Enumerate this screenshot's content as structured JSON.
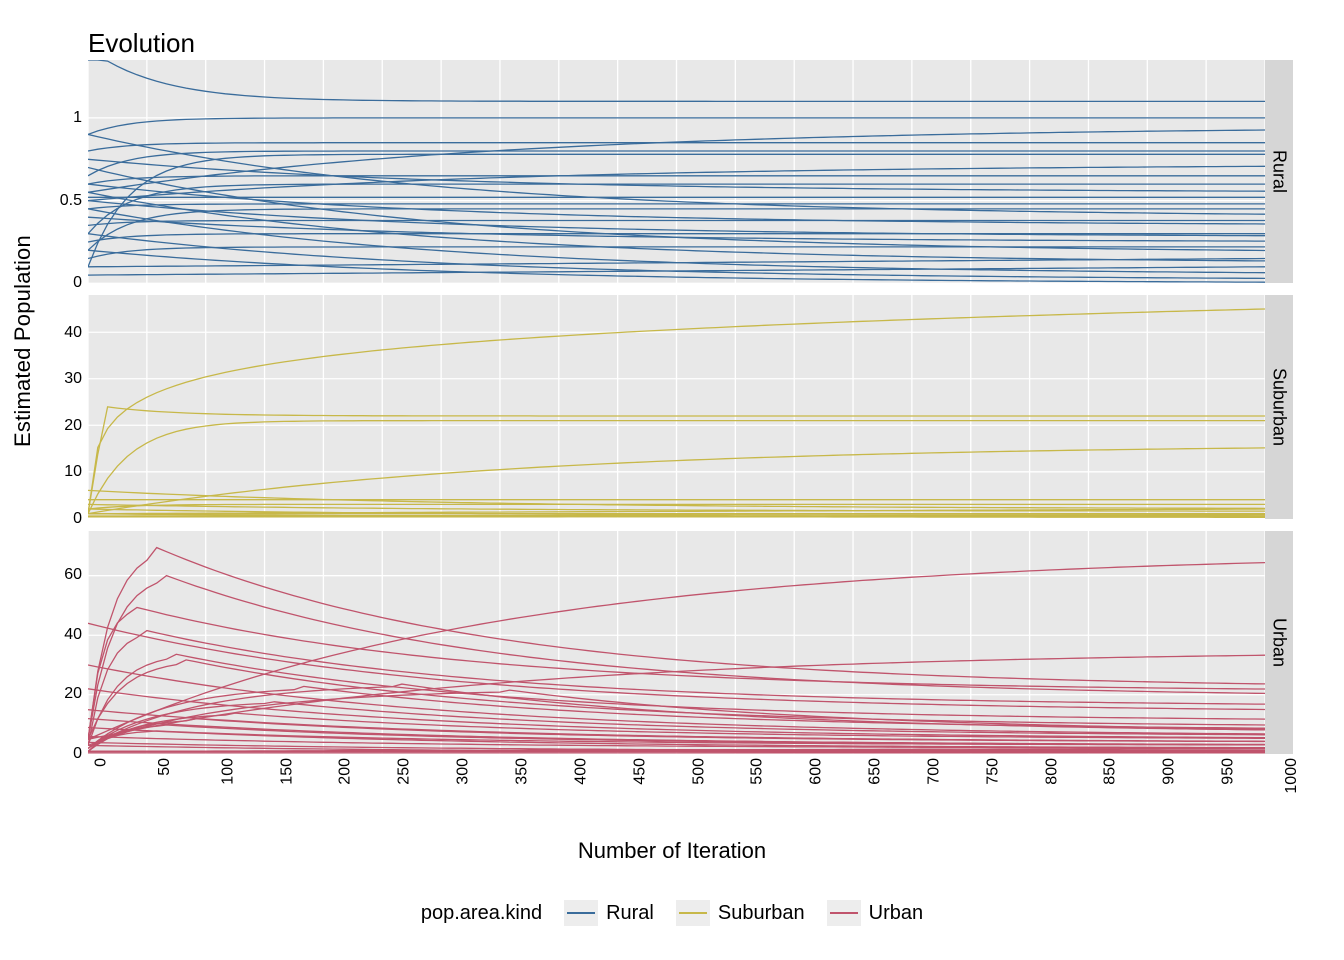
{
  "title": "Evolution",
  "xlabel": "Number of Iteration",
  "ylabel": "Estimated Population",
  "legend_title": "pop.area.kind",
  "colors": {
    "Rural": "#3A6C9B",
    "Suburban": "#C7B849",
    "Urban": "#C0546C"
  },
  "x_ticks": [
    0,
    50,
    100,
    150,
    200,
    250,
    300,
    350,
    400,
    450,
    500,
    550,
    600,
    650,
    700,
    750,
    800,
    850,
    900,
    950,
    1000
  ],
  "chart_data": [
    {
      "type": "line",
      "facet": "Rural",
      "color_key": "Rural",
      "xlim": [
        0,
        1000
      ],
      "ylim": [
        0,
        1.35
      ],
      "y_ticks": [
        0.0,
        0.5,
        1.0
      ],
      "series": [
        {
          "start": 1.35,
          "end": 1.1,
          "shape": "spike-then-flat"
        },
        {
          "start": 0.9,
          "end": 1.0,
          "shape": "fast-asymptote"
        },
        {
          "start": 0.55,
          "end": 0.95,
          "shape": "slow-rise"
        },
        {
          "start": 0.8,
          "end": 0.85,
          "shape": "fast-asymptote"
        },
        {
          "start": 0.65,
          "end": 0.8,
          "shape": "fast-asymptote"
        },
        {
          "start": 0.1,
          "end": 0.78,
          "shape": "fast-asymptote"
        },
        {
          "start": 0.5,
          "end": 0.72,
          "shape": "slow-rise"
        },
        {
          "start": 0.6,
          "end": 0.65,
          "shape": "fast-asymptote"
        },
        {
          "start": 0.3,
          "end": 0.6,
          "shape": "fast-asymptote"
        },
        {
          "start": 0.75,
          "end": 0.55,
          "shape": "slow-decay"
        },
        {
          "start": 0.52,
          "end": 0.52,
          "shape": "flat"
        },
        {
          "start": 0.45,
          "end": 0.48,
          "shape": "fast-asymptote"
        },
        {
          "start": 0.2,
          "end": 0.45,
          "shape": "fast-asymptote"
        },
        {
          "start": 0.9,
          "end": 0.4,
          "shape": "slow-decay"
        },
        {
          "start": 0.35,
          "end": 0.38,
          "shape": "fast-asymptote"
        },
        {
          "start": 0.6,
          "end": 0.35,
          "shape": "slow-decay"
        },
        {
          "start": 0.25,
          "end": 0.3,
          "shape": "fast-asymptote"
        },
        {
          "start": 0.5,
          "end": 0.28,
          "shape": "slow-decay"
        },
        {
          "start": 0.4,
          "end": 0.25,
          "shape": "slow-decay"
        },
        {
          "start": 0.15,
          "end": 0.22,
          "shape": "fast-asymptote"
        },
        {
          "start": 0.7,
          "end": 0.18,
          "shape": "slow-decay"
        },
        {
          "start": 0.1,
          "end": 0.15,
          "shape": "flat"
        },
        {
          "start": 0.55,
          "end": 0.12,
          "shape": "slow-decay"
        },
        {
          "start": 0.05,
          "end": 0.1,
          "shape": "flat"
        },
        {
          "start": 0.45,
          "end": 0.05,
          "shape": "slow-decay"
        },
        {
          "start": 0.3,
          "end": 0.02,
          "shape": "slow-decay"
        },
        {
          "start": 0.2,
          "end": 0.0,
          "shape": "slow-decay"
        }
      ]
    },
    {
      "type": "line",
      "facet": "Suburban",
      "color_key": "Suburban",
      "xlim": [
        0,
        1000
      ],
      "ylim": [
        0,
        48
      ],
      "y_ticks": [
        0,
        10,
        20,
        30,
        40
      ],
      "series": [
        {
          "start": 1,
          "end": 45,
          "shape": "log-growth"
        },
        {
          "start": 1,
          "end": 22,
          "shape": "spike-then-flat",
          "spike": 24
        },
        {
          "start": 1,
          "end": 21,
          "shape": "fast-asymptote"
        },
        {
          "start": 1,
          "end": 16,
          "shape": "slow-rise"
        },
        {
          "start": 4,
          "end": 4,
          "shape": "flat"
        },
        {
          "start": 2,
          "end": 3,
          "shape": "fast-asymptote"
        },
        {
          "start": 6,
          "end": 2,
          "shape": "slow-decay"
        },
        {
          "start": 1,
          "end": 2,
          "shape": "flat"
        },
        {
          "start": 3,
          "end": 1.5,
          "shape": "slow-decay"
        },
        {
          "start": 1,
          "end": 1,
          "shape": "flat"
        },
        {
          "start": 0.5,
          "end": 0.8,
          "shape": "flat"
        },
        {
          "start": 2,
          "end": 0.5,
          "shape": "slow-decay"
        },
        {
          "start": 0.3,
          "end": 0.4,
          "shape": "flat"
        },
        {
          "start": 1,
          "end": 0.2,
          "shape": "slow-decay"
        }
      ]
    },
    {
      "type": "line",
      "facet": "Urban",
      "color_key": "Urban",
      "xlim": [
        0,
        1000
      ],
      "ylim": [
        0,
        75
      ],
      "y_ticks": [
        0,
        20,
        40,
        60
      ],
      "series": [
        {
          "start": 5,
          "end": 68,
          "shape": "slow-rise"
        },
        {
          "start": 5,
          "end": 35,
          "shape": "slow-rise"
        },
        {
          "start": 5,
          "end": 22,
          "shape": "hump",
          "peak": 70,
          "peak_x": 55
        },
        {
          "start": 5,
          "end": 19,
          "shape": "hump",
          "peak": 61,
          "peak_x": 60
        },
        {
          "start": 5,
          "end": 21,
          "shape": "hump",
          "peak": 50,
          "peak_x": 35
        },
        {
          "start": 3,
          "end": 16,
          "shape": "hump",
          "peak": 42,
          "peak_x": 45
        },
        {
          "start": 44,
          "end": 14,
          "shape": "slow-decay"
        },
        {
          "start": 3,
          "end": 11,
          "shape": "hump",
          "peak": 34,
          "peak_x": 70
        },
        {
          "start": 5,
          "end": 9,
          "shape": "hump",
          "peak": 32,
          "peak_x": 80
        },
        {
          "start": 2,
          "end": 8,
          "shape": "hump",
          "peak": 23,
          "peak_x": 180
        },
        {
          "start": 2,
          "end": 7,
          "shape": "hump",
          "peak": 24,
          "peak_x": 260
        },
        {
          "start": 3,
          "end": 7,
          "shape": "hump",
          "peak": 22,
          "peak_x": 350
        },
        {
          "start": 30,
          "end": 6,
          "shape": "slow-decay"
        },
        {
          "start": 2,
          "end": 6,
          "shape": "hump",
          "peak": 18,
          "peak_x": 150
        },
        {
          "start": 1,
          "end": 5,
          "shape": "hump",
          "peak": 14,
          "peak_x": 120
        },
        {
          "start": 22,
          "end": 5,
          "shape": "slow-decay"
        },
        {
          "start": 1,
          "end": 4,
          "shape": "hump",
          "peak": 12,
          "peak_x": 90
        },
        {
          "start": 15,
          "end": 4,
          "shape": "slow-decay"
        },
        {
          "start": 1,
          "end": 3,
          "shape": "hump",
          "peak": 10,
          "peak_x": 60
        },
        {
          "start": 12,
          "end": 3,
          "shape": "slow-decay"
        },
        {
          "start": 1,
          "end": 3,
          "shape": "hump",
          "peak": 8,
          "peak_x": 50
        },
        {
          "start": 9,
          "end": 2,
          "shape": "slow-decay"
        },
        {
          "start": 1,
          "end": 2,
          "shape": "flat"
        },
        {
          "start": 6,
          "end": 2,
          "shape": "slow-decay"
        },
        {
          "start": 1,
          "end": 1.5,
          "shape": "flat"
        },
        {
          "start": 4,
          "end": 1,
          "shape": "slow-decay"
        },
        {
          "start": 1,
          "end": 1,
          "shape": "flat"
        },
        {
          "start": 3,
          "end": 0.5,
          "shape": "slow-decay"
        },
        {
          "start": 0.5,
          "end": 0.5,
          "shape": "flat"
        }
      ]
    }
  ]
}
